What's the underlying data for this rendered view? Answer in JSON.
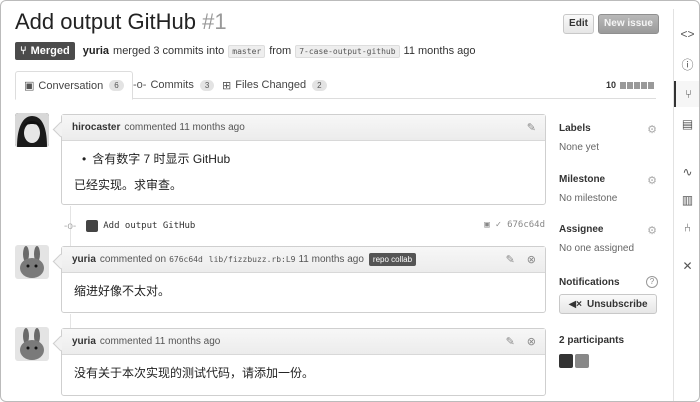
{
  "header": {
    "title": "Add output GitHub",
    "number": "#1",
    "edit_label": "Edit",
    "new_issue_label": "New issue"
  },
  "meta": {
    "status": "Merged",
    "author": "yuria",
    "text_merged": "merged 3 commits into",
    "base_branch": "master",
    "text_from": "from",
    "head_branch": "7-case-output-github",
    "time": "11 months ago"
  },
  "tabs": [
    {
      "label": "Conversation",
      "count": "6"
    },
    {
      "label": "Commits",
      "count": "3"
    },
    {
      "label": "Files Changed",
      "count": "2"
    }
  ],
  "diffstat": {
    "count": "10"
  },
  "comments": [
    {
      "author": "hirocaster",
      "action": "commented 11 months ago",
      "list_item": "含有数字 7 时显示 GitHub",
      "body": "已经实现。求审查。"
    },
    {
      "author": "yuria",
      "action": "commented on",
      "sha": "676c64d",
      "file": "lib/fizzbuzz.rb:L9",
      "time": "11 months ago",
      "label": "repo collab",
      "body": "缩进好像不太对。"
    },
    {
      "author": "yuria",
      "action": "commented 11 months ago",
      "body": "没有关于本次实现的测试代码，请添加一份。"
    }
  ],
  "commit": {
    "message": "Add output GitHub",
    "sha": "676c64d"
  },
  "sidebar": {
    "labels_title": "Labels",
    "labels_value": "None yet",
    "milestone_title": "Milestone",
    "milestone_value": "No milestone",
    "assignee_title": "Assignee",
    "assignee_value": "No one assigned",
    "notifications_title": "Notifications",
    "unsubscribe_label": "Unsubscribe",
    "participants_title": "2 participants"
  }
}
